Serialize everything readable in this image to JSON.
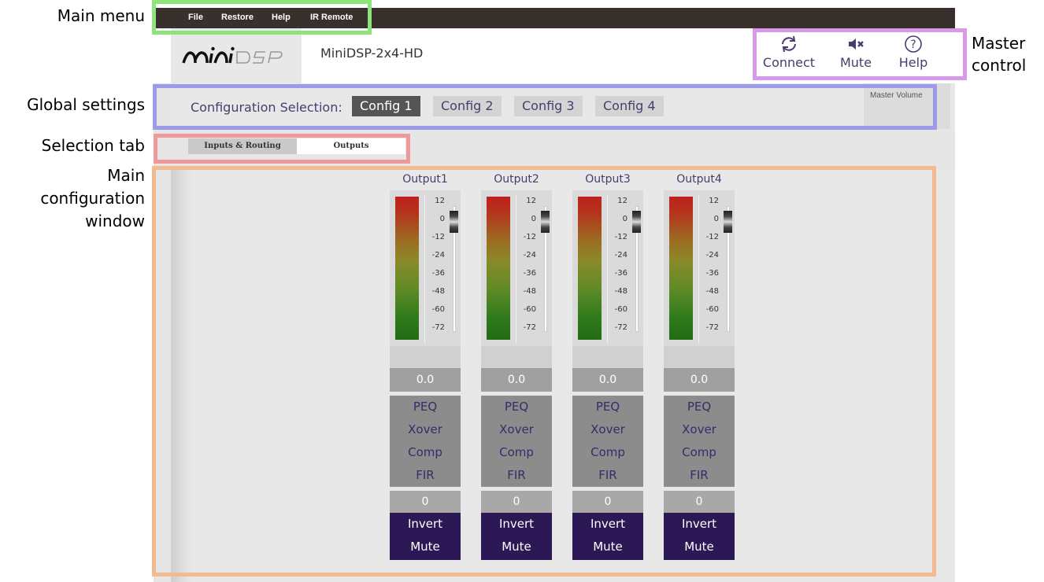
{
  "annotations": {
    "main_menu": "Main menu",
    "global_settings": "Global settings",
    "selection_tab": "Selection tab",
    "main_config_line1": "Main",
    "main_config_line2": "configuration",
    "main_config_line3": "window",
    "master_control_line1": "Master",
    "master_control_line2": "control"
  },
  "menu": {
    "file": "File",
    "restore": "Restore",
    "help": "Help",
    "ir_remote": "IR Remote"
  },
  "header": {
    "logo": "miniDSP",
    "device_name": "MiniDSP-2x4-HD"
  },
  "master_controls": {
    "connect": "Connect",
    "mute": "Mute",
    "help": "Help"
  },
  "global": {
    "config_label": "Configuration Selection:",
    "configs": [
      "Config 1",
      "Config 2",
      "Config 3",
      "Config 4"
    ],
    "active_config": "Config 1",
    "master_volume": "Master Volume"
  },
  "tabs": {
    "inputs_routing": "Inputs & Routing",
    "outputs": "Outputs",
    "active": "Outputs"
  },
  "meter_ticks": [
    "12",
    "0",
    "-12",
    "-24",
    "-36",
    "-48",
    "-60",
    "-72"
  ],
  "outputs": [
    {
      "name": "Output1",
      "gain": "0.0",
      "peq": "PEQ",
      "xover": "Xover",
      "comp": "Comp",
      "fir": "FIR",
      "delay": "0",
      "invert": "Invert",
      "mute": "Mute"
    },
    {
      "name": "Output2",
      "gain": "0.0",
      "peq": "PEQ",
      "xover": "Xover",
      "comp": "Comp",
      "fir": "FIR",
      "delay": "0",
      "invert": "Invert",
      "mute": "Mute"
    },
    {
      "name": "Output3",
      "gain": "0.0",
      "peq": "PEQ",
      "xover": "Xover",
      "comp": "Comp",
      "fir": "FIR",
      "delay": "0",
      "invert": "Invert",
      "mute": "Mute"
    },
    {
      "name": "Output4",
      "gain": "0.0",
      "peq": "PEQ",
      "xover": "Xover",
      "comp": "Comp",
      "fir": "FIR",
      "delay": "0",
      "invert": "Invert",
      "mute": "Mute"
    }
  ],
  "colors": {
    "menubar": "#38302d",
    "accent_text": "#4a3b6e",
    "invert_mute_bg": "#2c1854",
    "annotation_main_menu": "#8ee37a",
    "annotation_global": "#9b9bea",
    "annotation_selection": "#ee9a9a",
    "annotation_main_window": "#f4b98e",
    "annotation_master": "#d89ae8"
  }
}
